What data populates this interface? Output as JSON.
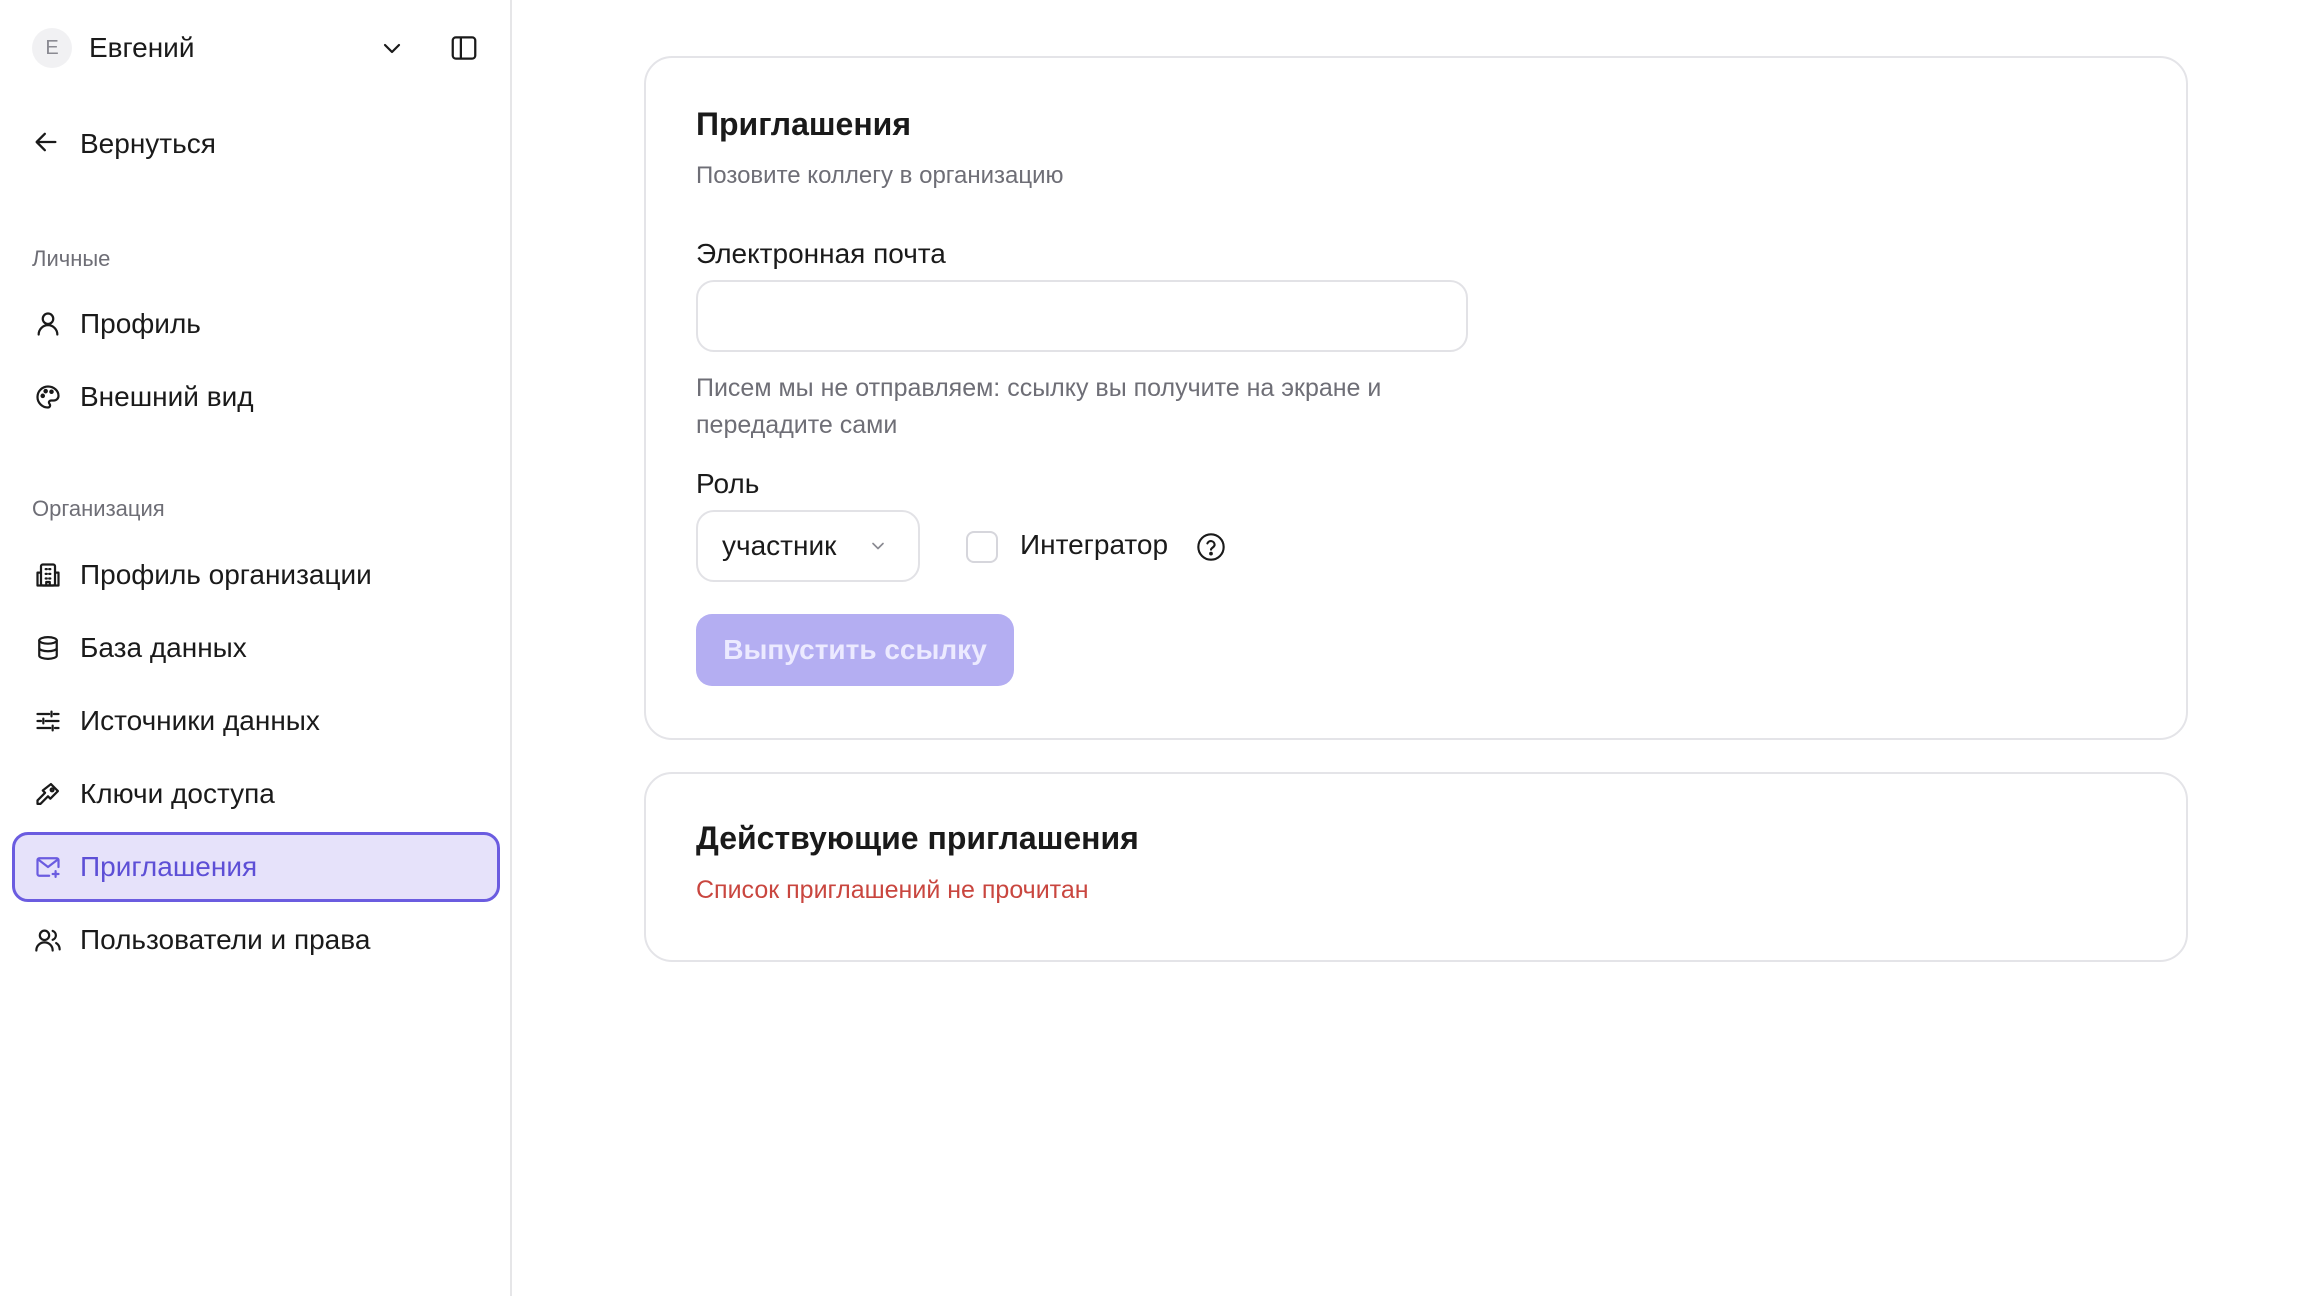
{
  "sidebar": {
    "user": {
      "avatar_letter": "Е",
      "name": "Евгений"
    },
    "back_label": "Вернуться",
    "sections": [
      {
        "title": "Личные",
        "items": [
          {
            "label": "Профиль",
            "icon": "user-icon"
          },
          {
            "label": "Внешний вид",
            "icon": "palette-icon"
          }
        ]
      },
      {
        "title": "Организация",
        "items": [
          {
            "label": "Профиль организации",
            "icon": "building-icon"
          },
          {
            "label": "База данных",
            "icon": "database-icon"
          },
          {
            "label": "Источники данных",
            "icon": "sliders-icon"
          },
          {
            "label": "Ключи доступа",
            "icon": "key-icon"
          },
          {
            "label": "Приглашения",
            "icon": "mail-plus-icon",
            "active": true
          },
          {
            "label": "Пользователи и права",
            "icon": "users-icon"
          }
        ]
      }
    ]
  },
  "invite_card": {
    "title": "Приглашения",
    "subtitle": "Позовите коллегу в организацию",
    "email_label": "Электронная почта",
    "email_value": "",
    "email_hint": "Писем мы не отправляем: ссылку вы получите на экране и передадите сами",
    "role_label": "Роль",
    "role_value": "участник",
    "integrator_label": "Интегратор",
    "integrator_checked": false,
    "submit_label": "Выпустить ссылку"
  },
  "active_card": {
    "title": "Действующие приглашения",
    "error": "Список приглашений не прочитан"
  },
  "colors": {
    "accent": "#6b5ce0",
    "accent_bg": "#e6e2fa",
    "button_disabled": "#b4aef2",
    "error": "#c9463f"
  }
}
